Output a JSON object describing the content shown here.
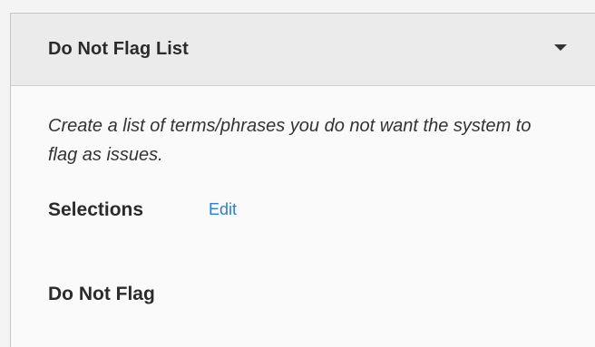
{
  "panel": {
    "title": "Do Not Flag List",
    "caret_icon": "caret-down-icon",
    "description": "Create a list of terms/phrases you do not want the system to flag as issues.",
    "selections_label": "Selections",
    "edit_label": "Edit",
    "do_not_flag_label": "Do Not Flag"
  },
  "colors": {
    "link": "#2a7fd4",
    "header_bg": "#ebebeb",
    "text": "#2b2b2b"
  }
}
